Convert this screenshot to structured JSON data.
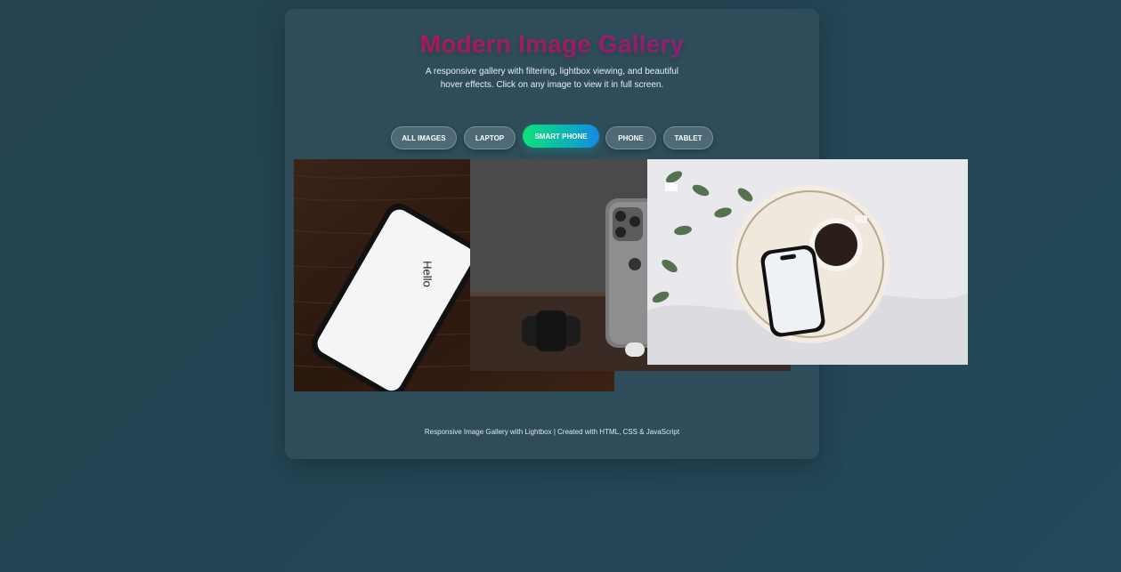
{
  "header": {
    "title": "Modern Image Gallery",
    "subtitle": "A responsive gallery with filtering, lightbox viewing, and beautiful hover effects. Click on any image to view it in full screen."
  },
  "filters": {
    "items": [
      {
        "label": "ALL IMAGES",
        "active": false
      },
      {
        "label": "LAPTOP",
        "active": false
      },
      {
        "label": "SMART PHONE",
        "active": true
      },
      {
        "label": "PHONE",
        "active": false
      },
      {
        "label": "TABLET",
        "active": false
      }
    ]
  },
  "gallery": {
    "images": [
      {
        "name": "phone-wood-image",
        "screen_text": "Hello"
      },
      {
        "name": "phone-watch-image"
      },
      {
        "name": "phone-coffee-image"
      }
    ]
  },
  "footer": {
    "text": "Responsive Image Gallery with Lightbox | Created with HTML, CSS & JavaScript"
  },
  "colors": {
    "background": "#24424f",
    "card": "#2e4c59",
    "title_gradient_start": "#c41a54",
    "title_gradient_end": "#8f2a8d",
    "active_filter_start": "#10e07b",
    "active_filter_end": "#1688e6",
    "filter_button": "#4e6a76"
  },
  "icons": {
    "image_tiles": [
      "phone-wood-image",
      "phone-watch-image",
      "phone-coffee-image"
    ]
  }
}
